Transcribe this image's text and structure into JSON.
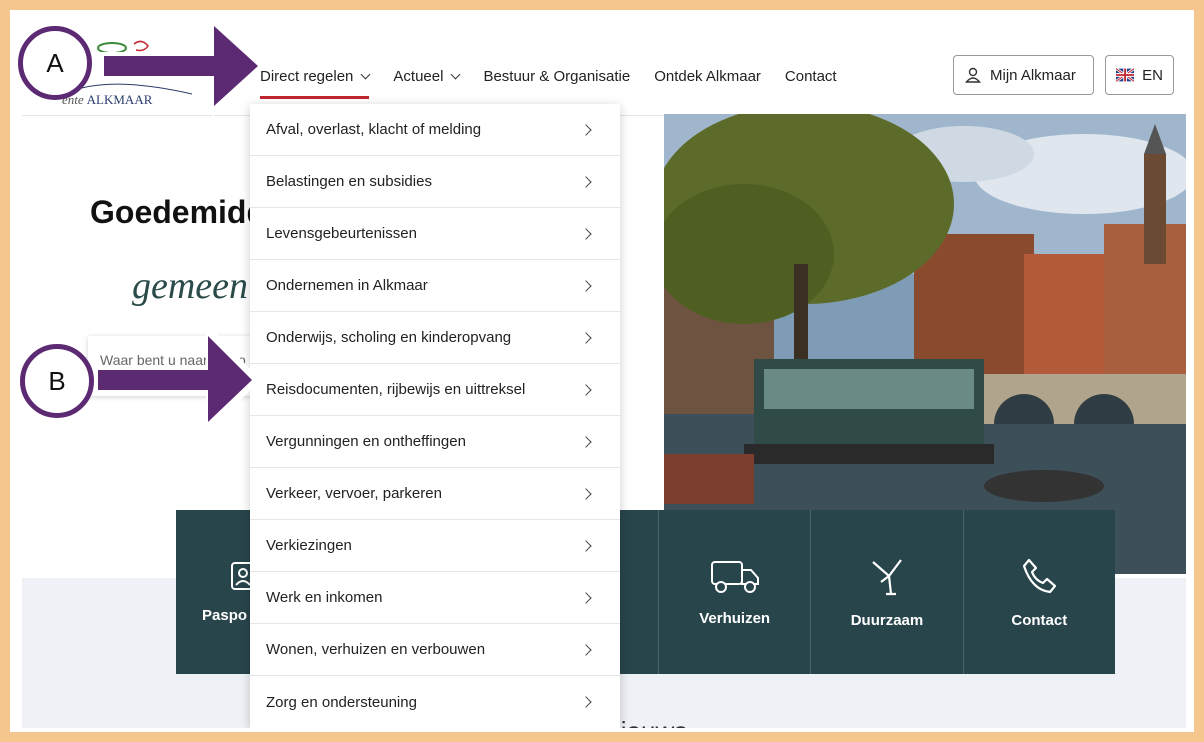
{
  "header": {
    "logo_text": "ALKMAAR",
    "logo_prefix": "ente",
    "nav": [
      {
        "label": "Direct regelen"
      },
      {
        "label": "Actueel"
      },
      {
        "label": "Bestuur & Organisatie"
      },
      {
        "label": "Ontdek Alkmaar"
      },
      {
        "label": "Contact"
      }
    ],
    "mijn_label": "Mijn Alkmaar",
    "lang_label": "EN"
  },
  "hero": {
    "title": "Goedemidd",
    "subtitle": "gemeen",
    "search_placeholder": "Waar bent u naar op zo"
  },
  "dropdown": {
    "items": [
      {
        "label": "Afval, overlast, klacht of melding"
      },
      {
        "label": "Belastingen en subsidies"
      },
      {
        "label": "Levensgebeurtenissen"
      },
      {
        "label": "Ondernemen in Alkmaar"
      },
      {
        "label": "Onderwijs, scholing en kinderopvang"
      },
      {
        "label": "Reisdocumenten, rijbewijs en uittreksel"
      },
      {
        "label": "Vergunningen en ontheffingen"
      },
      {
        "label": "Verkeer, vervoer, parkeren"
      },
      {
        "label": "Verkiezingen"
      },
      {
        "label": "Werk en inkomen"
      },
      {
        "label": "Wonen, verhuizen en verbouwen"
      },
      {
        "label": "Zorg en ondersteuning"
      }
    ]
  },
  "tiles": [
    {
      "label": "Paspo",
      "icon": "id-card-icon"
    },
    {
      "label": "",
      "icon": ""
    },
    {
      "label": "",
      "icon": ""
    },
    {
      "label": "Verhuizen",
      "icon": "truck-icon"
    },
    {
      "label": "Duurzaam",
      "icon": "windmill-icon"
    },
    {
      "label": "Contact",
      "icon": "phone-icon"
    }
  ],
  "news_heading": "Nieuws",
  "annotations": {
    "a": "A",
    "b": "B"
  },
  "colors": {
    "frame": "#f5c78f",
    "annotation": "#5c2a73",
    "tile_bg": "#28454b",
    "active_underline": "#c0262d"
  }
}
